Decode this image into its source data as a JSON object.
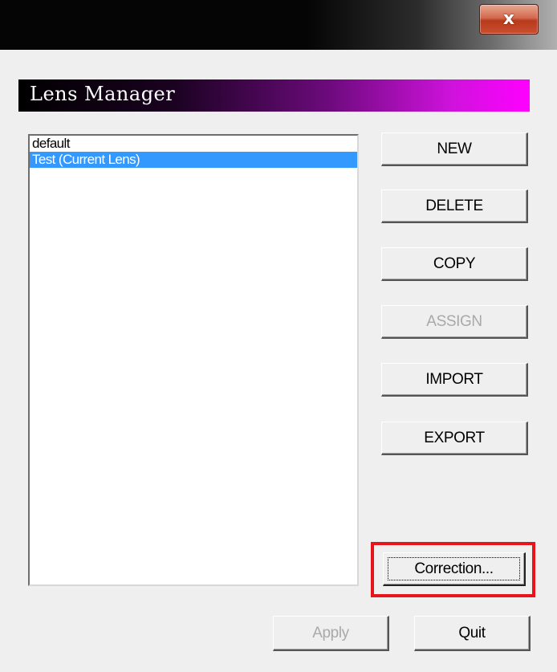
{
  "window": {
    "close_glyph": "x"
  },
  "header": {
    "title": "Lens Manager"
  },
  "lens_list": {
    "items": [
      {
        "label": "default",
        "selected": false
      },
      {
        "label": "Test (Current Lens)",
        "selected": true
      }
    ]
  },
  "buttons": {
    "new": "NEW",
    "delete": "DELETE",
    "copy": "COPY",
    "assign": "ASSIGN",
    "import": "IMPORT",
    "export": "EXPORT",
    "correction": "Correction...",
    "apply": "Apply",
    "quit": "Quit"
  },
  "colors": {
    "selection": "#3399ff",
    "highlight_border": "#e8141c",
    "banner_end": "#ff00ff"
  }
}
